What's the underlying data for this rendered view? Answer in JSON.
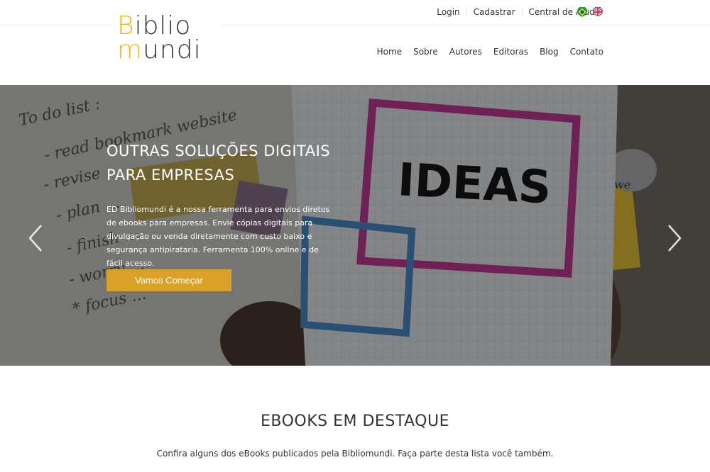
{
  "topbar": {
    "links": [
      "Login",
      "Cadastrar",
      "Central de Ajuda"
    ],
    "flags": [
      "brazil-flag-icon",
      "uk-flag-icon"
    ]
  },
  "logo": {
    "line1_y": "B",
    "line1_d": "iblio",
    "line2_y": "m",
    "line2_d": "undi",
    "brand_color": "#f2b705"
  },
  "nav": {
    "items": [
      "Home",
      "Sobre",
      "Autores",
      "Editoras",
      "Blog",
      "Contato"
    ]
  },
  "hero": {
    "title": "OUTRAS SOLUÇÕES DIGITAIS PARA EMPRESAS",
    "text": "ED Bibliomundi é a nossa ferramenta para envios diretos de ebooks para empresas. Envie cópias digitais para divulgação ou venda diretamente com custo baixo e segurança antipirataria. Ferramenta 100% online e de fácil acesso.",
    "button": "Vamos Começar",
    "button_color": "#d9a02a",
    "image_words": {
      "list": [
        "To do list :",
        "- read bookmark website",
        "- revise ...",
        "- plan ...",
        "- finish ...",
        "- worry ...",
        "* focus ..."
      ],
      "tablet": "IDEAS",
      "note": "we"
    }
  },
  "featured": {
    "title": "EBOOKS EM DESTAQUE",
    "subtitle": "Confira alguns dos eBooks publicados pela Bibliomundi. Faça parte desta lista você também."
  }
}
